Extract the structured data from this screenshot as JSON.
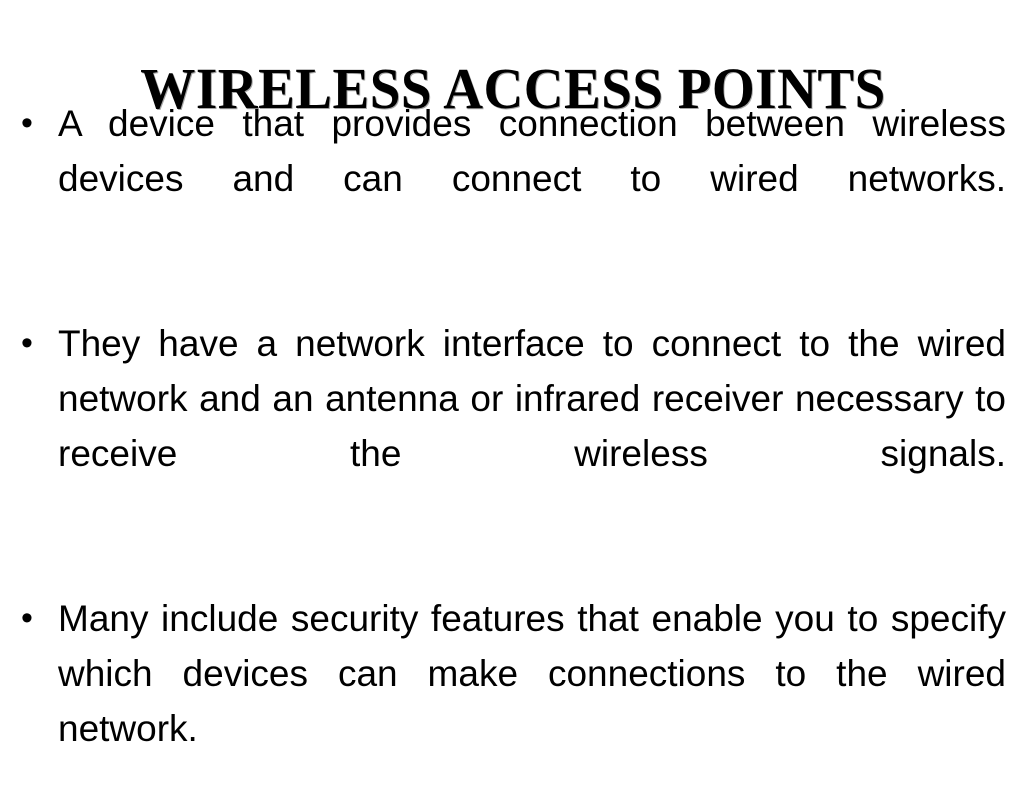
{
  "slide": {
    "title": "WIRELESS ACCESS POINTS",
    "background_color": "#ffffff",
    "text_color": "#000000",
    "bullet_glyph": "•",
    "bullets": [
      {
        "marker": "•",
        "text": "A device that provides connection between wireless devices and can connect to wired networks."
      },
      {
        "marker": "•",
        "text": "They have a network interface to connect to the wired network and an antenna or infrared receiver necessary to receive the wireless signals."
      },
      {
        "marker": "•",
        "text": "Many include security features that enable you to specify which devices can make connections to the wired network."
      }
    ]
  }
}
